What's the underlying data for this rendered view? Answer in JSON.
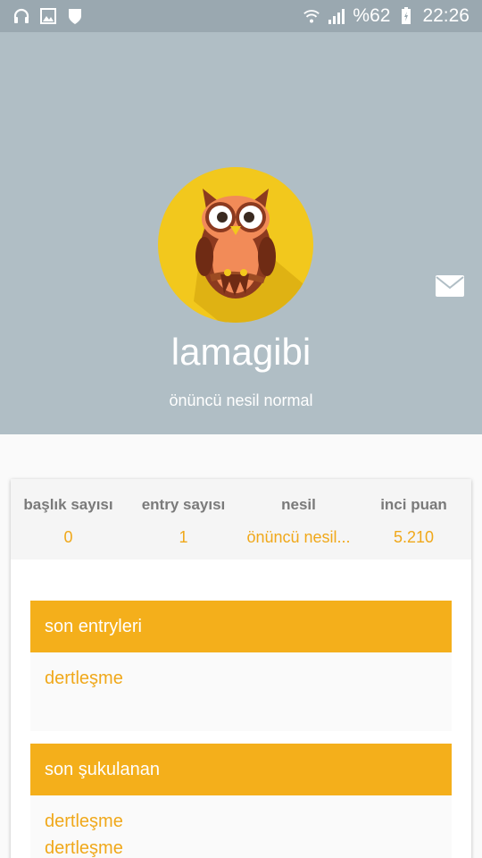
{
  "statusbar": {
    "battery": "%62",
    "time": "22:26",
    "icons": [
      "headphones-icon",
      "image-icon",
      "shield-icon",
      "wifi-icon",
      "signal-icon",
      "battery-icon"
    ]
  },
  "profile": {
    "username": "lamagibi",
    "generation_title": "önüncü nesil normal",
    "avatar": "owl-avatar",
    "message_icon": "mail-icon"
  },
  "stats": [
    {
      "label": "başlık sayısı",
      "value": "0"
    },
    {
      "label": "entry sayısı",
      "value": "1"
    },
    {
      "label": "nesil",
      "value": "önüncü nesil..."
    },
    {
      "label": "inci puan",
      "value": "5.210"
    }
  ],
  "sections": {
    "recent_entries": {
      "title": "son entryleri",
      "items": [
        "dertleşme"
      ]
    },
    "recent_upvoted": {
      "title": "son şukulanan",
      "items": [
        "dertleşme",
        "dertleşme"
      ]
    }
  },
  "colors": {
    "header_bg": "#b0bec5",
    "accent": "#f4af1b",
    "link": "#f0a81a"
  }
}
